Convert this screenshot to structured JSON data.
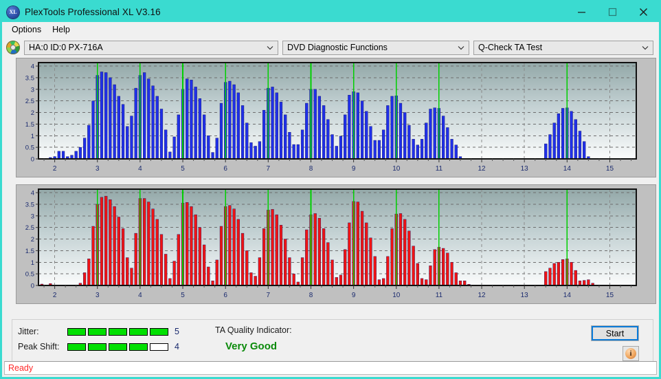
{
  "window": {
    "title": "PlexTools Professional XL V3.16",
    "icon": "xl-disc-icon",
    "minimize": "minimize-icon",
    "maximize": "maximize-icon",
    "close": "close-icon"
  },
  "menubar": {
    "items": [
      {
        "label": "Options"
      },
      {
        "label": "Help"
      }
    ]
  },
  "toolbar": {
    "drive_icon": "disc-icon",
    "drive_select": "HA:0 ID:0  PX-716A",
    "function_select": "DVD Diagnostic Functions",
    "test_select": "Q-Check TA Test"
  },
  "results": {
    "jitter_label": "Jitter:",
    "jitter_value": "5",
    "jitter_filled": 5,
    "jitter_total": 5,
    "peak_shift_label": "Peak Shift:",
    "peak_shift_value": "4",
    "peak_shift_filled": 4,
    "peak_shift_total": 5,
    "quality_label": "TA Quality Indicator:",
    "quality_value": "Very Good",
    "quality_color": "#0a8a0a",
    "start_label": "Start",
    "info_label": "i"
  },
  "statusbar": {
    "text": "Ready",
    "color": "#ff2a2a"
  },
  "chart_data": [
    {
      "id": "jitter-chart",
      "type": "bar",
      "title": "",
      "xlabel": "",
      "ylabel": "",
      "color": "#1a2ae0",
      "bar_color": "#2030e8",
      "marker_color": "#00d000",
      "xlim": [
        1.62,
        15.62
      ],
      "ylim": [
        0,
        4.15
      ],
      "yticks": [
        0,
        0.5,
        1,
        1.5,
        2,
        2.5,
        3,
        3.5,
        4
      ],
      "ytick_labels": [
        "0",
        "0.5",
        "1",
        "1.5",
        "2",
        "2.5",
        "3",
        "3.5",
        "4"
      ],
      "xticks": [
        2,
        3,
        4,
        5,
        6,
        7,
        8,
        9,
        10,
        11,
        12,
        13,
        14,
        15
      ],
      "xtick_labels": [
        "2",
        "3",
        "4",
        "5",
        "6",
        "7",
        "8",
        "9",
        "10",
        "11",
        "12",
        "13",
        "14",
        "15"
      ],
      "markers": [
        3,
        4,
        5,
        6,
        7,
        8,
        9,
        10,
        11,
        14
      ],
      "grid": true,
      "x": [
        1.7,
        1.8,
        1.9,
        2.0,
        2.1,
        2.2,
        2.3,
        2.4,
        2.5,
        2.6,
        2.7,
        2.8,
        2.9,
        3.0,
        3.1,
        3.2,
        3.3,
        3.4,
        3.5,
        3.6,
        3.7,
        3.8,
        3.9,
        4.0,
        4.1,
        4.2,
        4.3,
        4.4,
        4.5,
        4.6,
        4.7,
        4.8,
        4.9,
        5.0,
        5.1,
        5.2,
        5.3,
        5.4,
        5.5,
        5.6,
        5.7,
        5.8,
        5.9,
        6.0,
        6.1,
        6.2,
        6.3,
        6.4,
        6.5,
        6.6,
        6.7,
        6.8,
        6.9,
        7.0,
        7.1,
        7.2,
        7.3,
        7.4,
        7.5,
        7.6,
        7.7,
        7.8,
        7.9,
        8.0,
        8.1,
        8.2,
        8.3,
        8.4,
        8.5,
        8.6,
        8.7,
        8.8,
        8.9,
        9.0,
        9.1,
        9.2,
        9.3,
        9.4,
        9.5,
        9.6,
        9.7,
        9.8,
        9.9,
        10.0,
        10.1,
        10.2,
        10.3,
        10.4,
        10.5,
        10.6,
        10.7,
        10.8,
        10.9,
        11.0,
        11.1,
        11.2,
        11.3,
        11.4,
        11.5,
        11.6,
        11.7,
        11.8,
        11.9,
        12.0,
        12.5,
        13.0,
        13.4,
        13.5,
        13.6,
        13.7,
        13.8,
        13.9,
        14.0,
        14.1,
        14.2,
        14.3,
        14.4,
        14.5,
        14.6,
        15.0
      ],
      "values": [
        0.02,
        0.02,
        0.06,
        0.1,
        0.33,
        0.33,
        0.1,
        0.16,
        0.33,
        0.5,
        0.9,
        1.45,
        2.5,
        3.6,
        3.75,
        3.72,
        3.5,
        3.2,
        2.7,
        2.35,
        1.4,
        1.85,
        3.05,
        3.6,
        3.72,
        3.45,
        3.15,
        2.7,
        2.15,
        1.25,
        0.3,
        0.95,
        1.9,
        3.0,
        3.45,
        3.4,
        3.1,
        2.6,
        1.9,
        1.0,
        0.28,
        0.9,
        2.4,
        3.3,
        3.35,
        3.2,
        2.85,
        2.3,
        1.55,
        0.7,
        0.55,
        0.75,
        2.1,
        3.05,
        3.1,
        2.85,
        2.45,
        1.9,
        1.15,
        0.62,
        0.62,
        1.25,
        2.4,
        3.0,
        3.0,
        2.7,
        2.3,
        1.7,
        1.05,
        0.55,
        0.98,
        1.9,
        2.75,
        2.9,
        2.85,
        2.5,
        2.05,
        1.4,
        0.8,
        0.8,
        1.25,
        2.3,
        2.7,
        2.72,
        2.4,
        2.0,
        1.45,
        0.85,
        0.6,
        0.85,
        1.55,
        2.15,
        2.2,
        2.18,
        1.85,
        1.35,
        0.85,
        0.6,
        0.1,
        0.02,
        0.02,
        0.02,
        0.02,
        0.02,
        0.02,
        0.02,
        0.02,
        0.65,
        1.05,
        1.55,
        1.95,
        2.18,
        2.2,
        2.05,
        1.7,
        1.2,
        0.75,
        0.1
      ]
    },
    {
      "id": "peak-shift-chart",
      "type": "bar",
      "title": "",
      "xlabel": "",
      "ylabel": "",
      "color": "#e81010",
      "bar_color": "#f01414",
      "marker_color": "#00d000",
      "xlim": [
        1.62,
        15.62
      ],
      "ylim": [
        0,
        4.15
      ],
      "yticks": [
        0,
        0.5,
        1,
        1.5,
        2,
        2.5,
        3,
        3.5,
        4
      ],
      "ytick_labels": [
        "0",
        "0.5",
        "1",
        "1.5",
        "2",
        "2.5",
        "3",
        "3.5",
        "4"
      ],
      "xticks": [
        2,
        3,
        4,
        5,
        6,
        7,
        8,
        9,
        10,
        11,
        12,
        13,
        14,
        15
      ],
      "xtick_labels": [
        "2",
        "3",
        "4",
        "5",
        "6",
        "7",
        "8",
        "9",
        "10",
        "11",
        "12",
        "13",
        "14",
        "15"
      ],
      "markers": [
        3,
        4,
        5,
        6,
        7,
        8,
        9,
        10,
        11,
        14
      ],
      "grid": true,
      "x": [
        1.7,
        1.8,
        1.9,
        2.0,
        2.1,
        2.2,
        2.3,
        2.4,
        2.5,
        2.6,
        2.7,
        2.8,
        2.9,
        3.0,
        3.1,
        3.2,
        3.3,
        3.4,
        3.5,
        3.6,
        3.7,
        3.8,
        3.9,
        4.0,
        4.1,
        4.2,
        4.3,
        4.4,
        4.5,
        4.6,
        4.7,
        4.8,
        4.9,
        5.0,
        5.1,
        5.2,
        5.3,
        5.4,
        5.5,
        5.6,
        5.7,
        5.8,
        5.9,
        6.0,
        6.1,
        6.2,
        6.3,
        6.4,
        6.5,
        6.6,
        6.7,
        6.8,
        6.9,
        7.0,
        7.1,
        7.2,
        7.3,
        7.4,
        7.5,
        7.6,
        7.7,
        7.8,
        7.9,
        8.0,
        8.1,
        8.2,
        8.3,
        8.4,
        8.5,
        8.6,
        8.7,
        8.8,
        8.9,
        9.0,
        9.1,
        9.2,
        9.3,
        9.4,
        9.5,
        9.6,
        9.7,
        9.8,
        9.9,
        10.0,
        10.1,
        10.2,
        10.3,
        10.4,
        10.5,
        10.6,
        10.7,
        10.8,
        10.9,
        11.0,
        11.1,
        11.2,
        11.3,
        11.4,
        11.5,
        11.6,
        11.7,
        12.0,
        12.5,
        13.0,
        13.4,
        13.5,
        13.6,
        13.7,
        13.8,
        13.9,
        14.0,
        14.1,
        14.2,
        14.3,
        14.4,
        14.5,
        14.6,
        15.0
      ],
      "values": [
        0.06,
        0.02,
        0.08,
        0.02,
        0.02,
        0.02,
        0.02,
        0.02,
        0.02,
        0.1,
        0.55,
        1.15,
        2.55,
        3.5,
        3.8,
        3.85,
        3.7,
        3.4,
        2.95,
        2.45,
        1.2,
        0.75,
        2.25,
        3.75,
        3.75,
        3.6,
        3.3,
        2.85,
        2.2,
        1.35,
        0.3,
        1.05,
        2.2,
        3.55,
        3.58,
        3.4,
        3.05,
        2.5,
        1.75,
        0.8,
        0.2,
        1.1,
        2.55,
        3.4,
        3.45,
        3.3,
        2.85,
        2.25,
        1.5,
        0.55,
        0.4,
        1.2,
        2.45,
        3.25,
        3.28,
        3.05,
        2.6,
        2.0,
        1.2,
        0.5,
        0.15,
        1.2,
        2.4,
        3.05,
        3.1,
        2.9,
        2.45,
        1.85,
        1.1,
        0.35,
        0.45,
        1.55,
        2.7,
        3.62,
        3.6,
        3.2,
        2.7,
        2.05,
        1.25,
        0.25,
        0.3,
        1.25,
        2.45,
        3.08,
        3.1,
        2.85,
        2.35,
        1.7,
        0.95,
        0.3,
        0.25,
        0.85,
        1.55,
        1.65,
        1.6,
        1.4,
        1.0,
        0.55,
        0.2,
        0.2,
        0.05,
        0.02,
        0.02,
        0.02,
        0.02,
        0.6,
        0.75,
        0.95,
        1.0,
        1.12,
        1.15,
        1.0,
        0.65,
        0.2,
        0.22,
        0.25,
        0.1,
        0.02
      ]
    }
  ]
}
